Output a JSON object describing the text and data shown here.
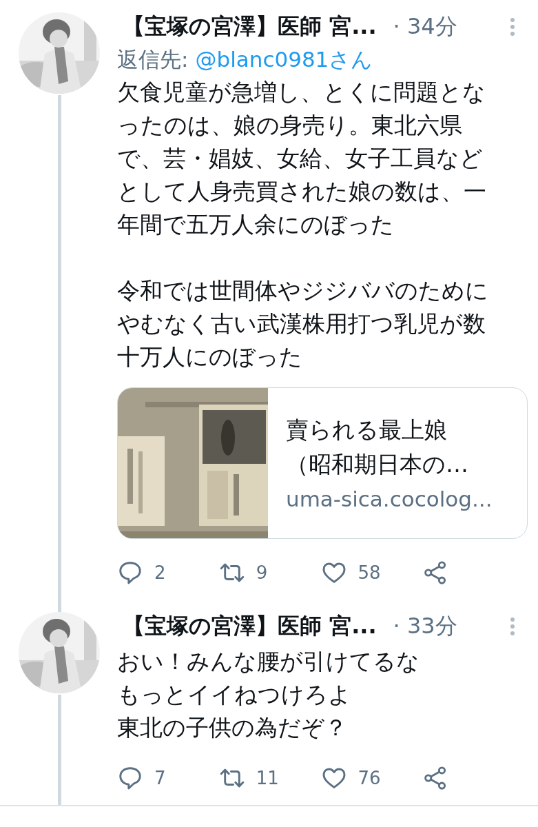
{
  "tweets": [
    {
      "name": "【宝塚の宮澤】医師 宮...",
      "time": "· 34分",
      "reply_to": {
        "label": "返信先:",
        "handle": "@blanc0981さん"
      },
      "paragraphs": [
        [
          "欠食児童が急増し、とくに問題とな",
          "ったのは、娘の身売り。東北六県",
          "で、芸・娼妓、女給、女子工員など",
          "として人身売買された娘の数は、一",
          "年間で五万人余にのぼった"
        ],
        [
          "令和では世間体やジジババのために",
          "やむなく古い武漢株用打つ乳児が数",
          "十万人にのぼった"
        ]
      ],
      "card": {
        "kind": "picture",
        "title": [
          "賣られる最上娘",
          "（昭和期日本の…"
        ],
        "domain": "uma-sica.cocolog..."
      },
      "actions": {
        "replies": "2",
        "retweets": "9",
        "likes": "58"
      }
    },
    {
      "name": "【宝塚の宮澤】医師 宮...",
      "time": "· 33分",
      "paragraphs": [
        [
          "おい！みんな腰が引けてるな",
          "もっとイイねつけろよ",
          "東北の子供の為だぞ？"
        ]
      ],
      "actions": {
        "replies": "7",
        "retweets": "11",
        "likes": "76"
      }
    }
  ]
}
